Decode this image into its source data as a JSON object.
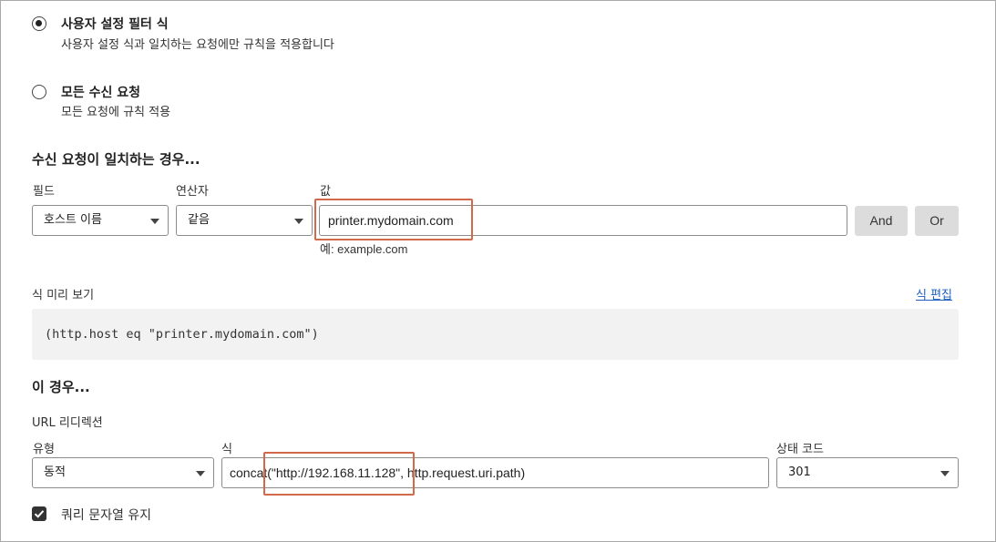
{
  "filter_options": [
    {
      "title": "사용자 설정 필터 식",
      "desc": "사용자 설정 식과 일치하는 요청에만 규칙을 적용합니다",
      "selected": true
    },
    {
      "title": "모든 수신 요청",
      "desc": "모든 요청에 규칙 적용",
      "selected": false
    }
  ],
  "match": {
    "heading": "수신 요청이 일치하는 경우...",
    "field_label": "필드",
    "field_value": "호스트 이름",
    "operator_label": "연산자",
    "operator_value": "같음",
    "value_label": "값",
    "value_value": "printer.mydomain.com",
    "value_hint": "예: example.com",
    "and_button": "And",
    "or_button": "Or"
  },
  "preview": {
    "label": "식 미리 보기",
    "edit_link": "식 편집",
    "expression": "(http.host eq \"printer.mydomain.com\")"
  },
  "then": {
    "heading": "이 경우...",
    "action_label": "URL 리디렉션",
    "type_label": "유형",
    "type_value": "동적",
    "expr_label": "식",
    "expr_value": "concat(\"http://192.168.11.128\", http.request.uri.path)",
    "status_label": "상태 코드",
    "status_value": "301",
    "preserve_query_label": "쿼리 문자열 유지",
    "preserve_query_checked": true
  },
  "highlight_color": "#d2694a",
  "link_color": "#1f5fbf"
}
